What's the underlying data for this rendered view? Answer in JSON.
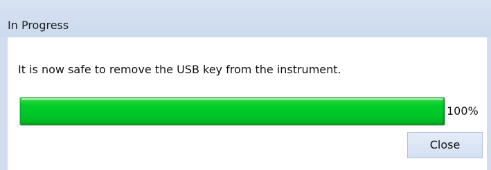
{
  "dialog": {
    "title": "In Progress",
    "message": "It is now safe to remove the USB key from the instrument.",
    "progress": {
      "fraction": 1.0,
      "label": "100%",
      "fill_color": "#00cd2a"
    },
    "close_label": "Close"
  }
}
